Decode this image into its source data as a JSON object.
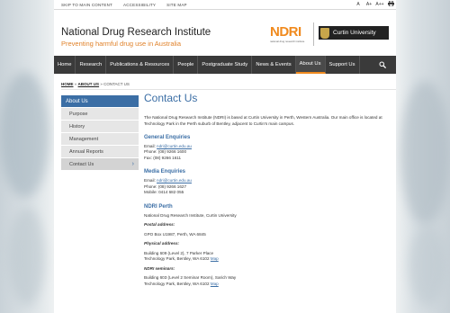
{
  "utility": {
    "skip": "SKIP TO MAIN CONTENT",
    "accessibility": "ACCESSIBILITY",
    "sitemap": "SITE MAP",
    "font_small": "A",
    "font_medium": "A+",
    "font_large": "A++"
  },
  "header": {
    "title": "National Drug Research Institute",
    "subtitle": "Preventing harmful drug use in Australia",
    "ndri_logo": "NDRI",
    "ndri_tag": "national drug research institute",
    "curtin_logo": "Curtin University"
  },
  "nav": {
    "items": [
      "Home",
      "Research",
      "Publications & Resources",
      "People",
      "Postgraduate Study",
      "News & Events",
      "About Us",
      "Support Us"
    ],
    "active": "About Us",
    "search_icon": "search-icon"
  },
  "breadcrumb": {
    "home": "HOME",
    "sep1": "»",
    "about": "ABOUT US",
    "sep2": "»",
    "current": "CONTACT US"
  },
  "sidebar": {
    "head": "About Us",
    "items": [
      "Purpose",
      "History",
      "Management",
      "Annual Reports",
      "Contact Us"
    ],
    "current": "Contact Us"
  },
  "main": {
    "title": "Contact Us",
    "intro": "The National Drug Research Institute (NDRI) is based at Curtin University in Perth, Western Australia. Our main office is located at Technology Park in the Perth suburb of Bentley, adjacent to Curtin's main campus.",
    "general": {
      "heading": "General Enquiries",
      "email_label": "Email: ",
      "email": "ndri@curtin.edu.au",
      "phone": "Phone: (08) 9266 1600",
      "fax": "Fax: (08) 9266 1611"
    },
    "media": {
      "heading": "Media Enquiries",
      "email_label": "Email: ",
      "email": "ndri@curtin.edu.au",
      "phone": "Phone: (08) 9266 1627",
      "mobile": "Mobile: 0414 682 055"
    },
    "perth": {
      "heading": "NDRI Perth",
      "org": "National Drug Research Institute, Curtin University",
      "postal_label": "Postal address:",
      "postal": "GPO Box U1987, Perth, WA 6845",
      "physical_label": "Physical address:",
      "physical_line1": "Building 609 (Level 2), 7 Parker Place",
      "physical_line2": "Technology Park, Bentley, WA 6102 ",
      "map": "Map",
      "seminars_label": "NDRI seminars:",
      "seminars_line1": "Building 603 (Level 2 Seminar Room), Sarich Way",
      "seminars_line2": "Technology Park, Bentley, WA 6102 "
    }
  }
}
